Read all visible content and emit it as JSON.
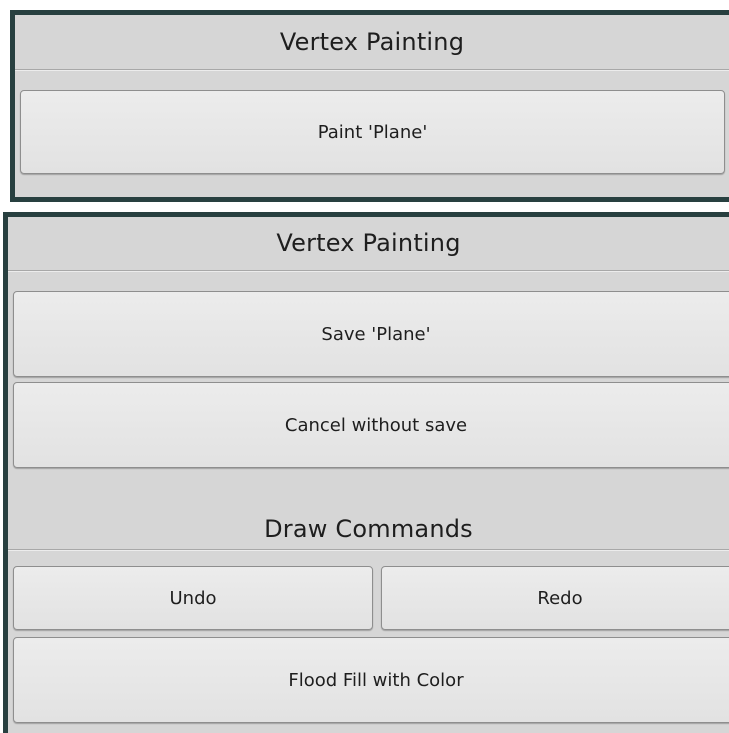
{
  "top_panel": {
    "header": "Vertex Painting",
    "paint_button": "Paint 'Plane'"
  },
  "bottom_panel": {
    "header": "Vertex Painting",
    "save_button": "Save 'Plane'",
    "cancel_button": "Cancel without save",
    "draw_commands_header": "Draw Commands",
    "undo_button": "Undo",
    "redo_button": "Redo",
    "flood_fill_button": "Flood Fill with Color"
  },
  "colors": {
    "panel_background": "#d6d6d6",
    "panel_border": "#284040",
    "button_background": "#e8e8e8",
    "text": "#1e1e1e"
  }
}
